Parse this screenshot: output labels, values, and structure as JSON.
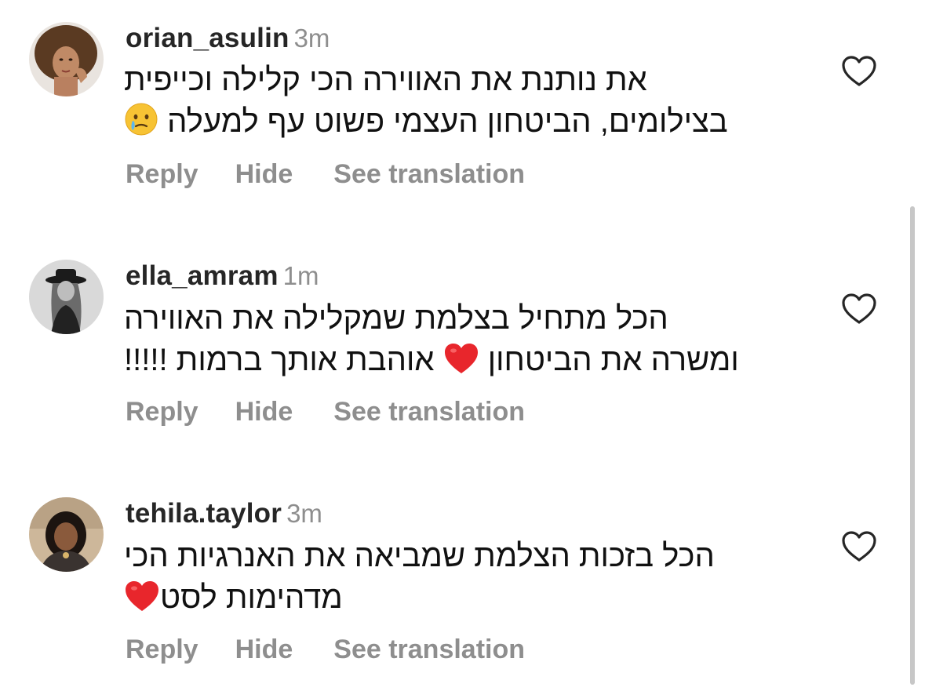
{
  "comments": [
    {
      "username": "orian_asulin",
      "time": "3m",
      "line1": "את נותנת את האווירה הכי קלילה וכייפית",
      "line2": "בצילומים, הביטחון העצמי פשוט עף למעלה",
      "emoji_icon": "crying-face-icon",
      "actions": {
        "reply": "Reply",
        "hide": "Hide",
        "translate": "See translation"
      }
    },
    {
      "username": "ella_amram",
      "time": "1m",
      "line1": "הכל מתחיל בצלמת שמקלילה את האווירה",
      "line2a": "ומשרה את הביטחון",
      "line2b": "אוהבת אותך ברמות !!!!!",
      "emoji_icon": "red-heart-icon",
      "actions": {
        "reply": "Reply",
        "hide": "Hide",
        "translate": "See translation"
      }
    },
    {
      "username": "tehila.taylor",
      "time": "3m",
      "line1": "הכל בזכות הצלמת שמביאה את האנרגיות הכי",
      "line2": "מדהימות לסט",
      "emoji_icon": "red-heart-icon",
      "actions": {
        "reply": "Reply",
        "hide": "Hide",
        "translate": "See translation"
      }
    }
  ],
  "colors": {
    "username": "#262626",
    "secondary": "#8e8e8e",
    "text": "#111111",
    "heart_stroke": "#262626"
  }
}
